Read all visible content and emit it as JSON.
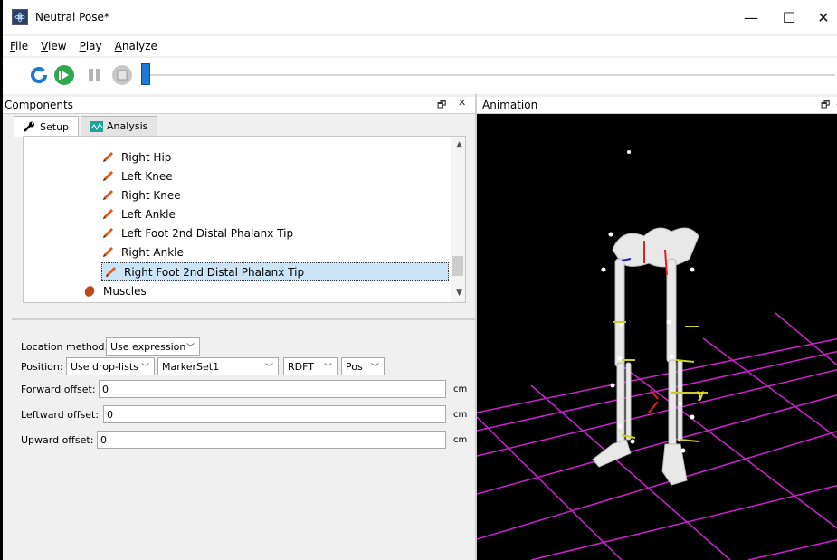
{
  "window": {
    "title": "Neutral Pose*",
    "controls": [
      "—",
      "☐",
      "✕"
    ]
  },
  "menu": [
    {
      "key": "F",
      "rest": "ile"
    },
    {
      "key": "V",
      "rest": "iew"
    },
    {
      "key": "P",
      "rest": "lay"
    },
    {
      "key": "A",
      "rest": "nalyze"
    }
  ],
  "toolbar": {
    "progress": 0.0
  },
  "components_panel": {
    "title": "Components",
    "tabs": [
      {
        "label": "Setup",
        "active": true
      },
      {
        "label": "Analysis",
        "active": false
      }
    ],
    "tree_items": [
      {
        "label": "Right Hip"
      },
      {
        "label": "Left Knee"
      },
      {
        "label": "Right Knee"
      },
      {
        "label": "Left Ankle"
      },
      {
        "label": "Left Foot 2nd Distal Phalanx Tip"
      },
      {
        "label": "Right Ankle"
      },
      {
        "label": "Right Foot 2nd Distal Phalanx Tip",
        "selected": true
      },
      {
        "label": "Muscles"
      }
    ]
  },
  "properties": {
    "location_method_label": "Location method:",
    "location_method_value": "Use expression",
    "position_label": "Position:",
    "position_mode": "Use drop-lists",
    "marker_set": "MarkerSet1",
    "marker": "RDFT",
    "component": "Pos",
    "forward_label": "Forward offset:",
    "forward_value": "0",
    "leftward_label": "Leftward offset:",
    "leftward_value": "0",
    "upward_label": "Upward offset:",
    "upward_value": "0",
    "unit": "cm"
  },
  "animation_panel": {
    "title": "Animation",
    "axis_label": "y"
  },
  "colors": {
    "grid": "#d020d0",
    "background": "#000000",
    "accent": "#1e78d6"
  }
}
